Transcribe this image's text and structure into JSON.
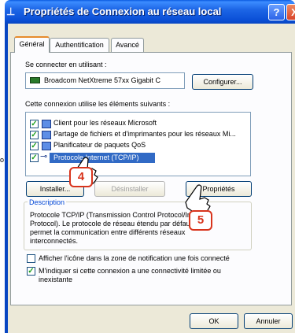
{
  "window": {
    "title": "Propriétés de Connexion au réseau local",
    "help_label": "?",
    "close_label": "X"
  },
  "tabs": [
    {
      "label": "Général"
    },
    {
      "label": "Authentification"
    },
    {
      "label": "Avancé"
    }
  ],
  "connect_using": {
    "label": "Se connecter en utilisant :",
    "adapter": "Broadcom NetXtreme 57xx Gigabit C",
    "configure_button": "Configurer..."
  },
  "components": {
    "label": "Cette connexion utilise les éléments suivants :",
    "items": [
      {
        "label": "Client pour les réseaux Microsoft",
        "checked": true
      },
      {
        "label": "Partage de fichiers et d'imprimantes pour les réseaux Mi...",
        "checked": true
      },
      {
        "label": "Planificateur de paquets QoS",
        "checked": true
      },
      {
        "label": "Protocole Internet (TCP/IP)",
        "checked": true,
        "selected": true
      }
    ]
  },
  "buttons": {
    "install": "Installer...",
    "uninstall": "Désinstaller",
    "properties": "Propriétés",
    "ok": "OK",
    "cancel": "Annuler"
  },
  "description": {
    "legend": "Description",
    "lines": [
      "Protocole TCP/IP (Transmission Control Protocol/Internet",
      "Protocol). Le protocole de réseau étendu par défaut qui",
      "permet la communication entre différents réseaux",
      "interconnectés."
    ]
  },
  "options": {
    "show_icon": {
      "label": "Afficher l'icône dans la zone de notification une fois connecté",
      "checked": false
    },
    "notify_limited": {
      "label_1": "M'indiquer si cette connexion a une connectivité limitée ou",
      "label_2": "inexistante",
      "checked": true
    }
  },
  "annotations": {
    "step_4": "4",
    "step_5": "5",
    "color": "#d8341c"
  },
  "left_edge_text": "o"
}
